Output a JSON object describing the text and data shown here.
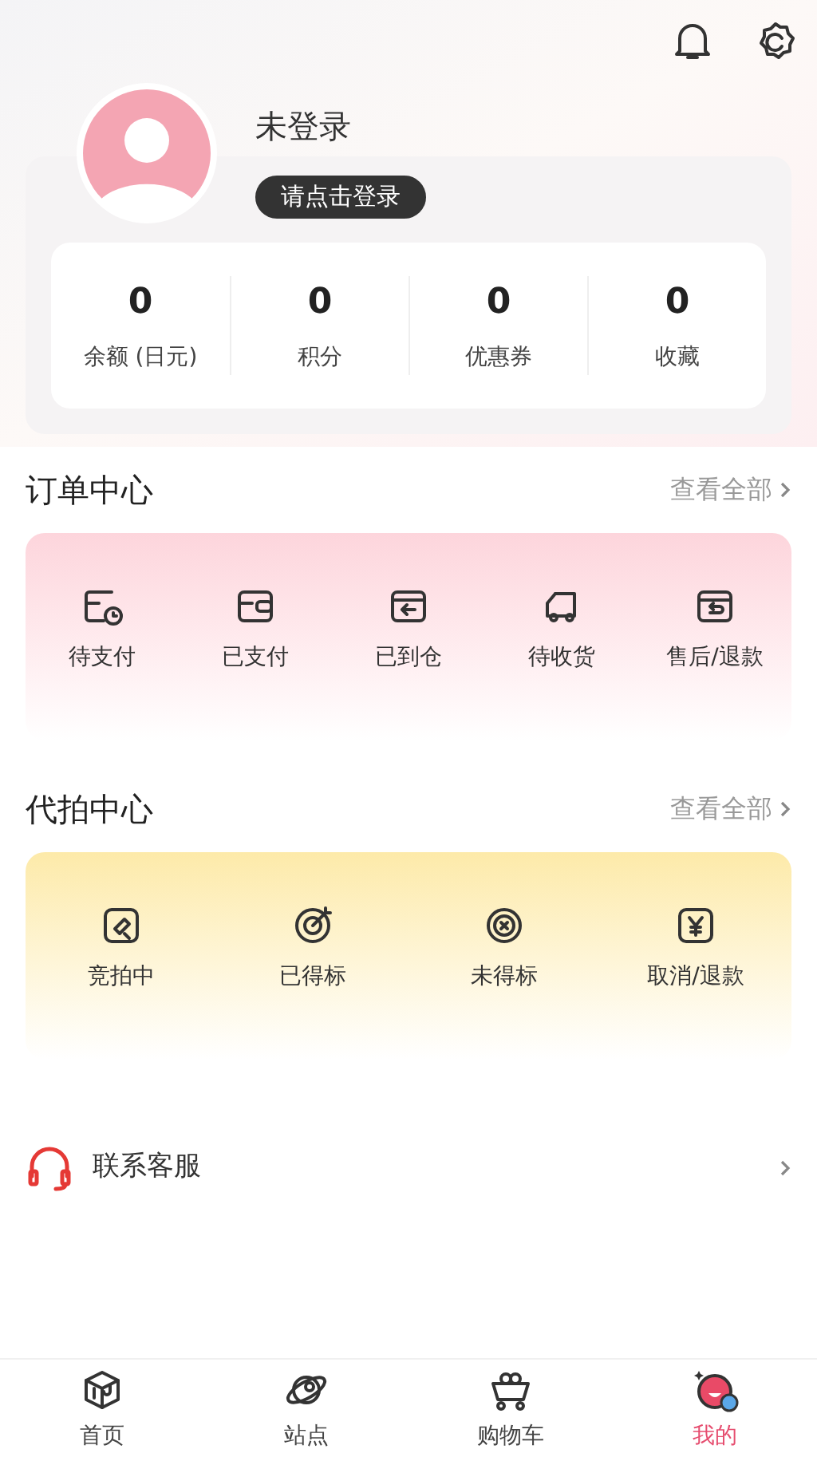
{
  "profile": {
    "name": "未登录",
    "login_button": "请点击登录"
  },
  "stats": [
    {
      "value": "0",
      "label": "余额 (日元)"
    },
    {
      "value": "0",
      "label": "积分"
    },
    {
      "value": "0",
      "label": "优惠券"
    },
    {
      "value": "0",
      "label": "收藏"
    }
  ],
  "order_center": {
    "title": "订单中心",
    "view_all": "查看全部",
    "items": [
      {
        "kind": "pending-pay",
        "label": "待支付"
      },
      {
        "kind": "paid",
        "label": "已支付"
      },
      {
        "kind": "arrived",
        "label": "已到仓"
      },
      {
        "kind": "shipping",
        "label": "待收货"
      },
      {
        "kind": "refund",
        "label": "售后/退款"
      }
    ]
  },
  "bid_center": {
    "title": "代拍中心",
    "view_all": "查看全部",
    "items": [
      {
        "kind": "bidding",
        "label": "竞拍中"
      },
      {
        "kind": "won",
        "label": "已得标"
      },
      {
        "kind": "lost",
        "label": "未得标"
      },
      {
        "kind": "cancel",
        "label": "取消/退款"
      }
    ]
  },
  "service": {
    "label": "联系客服"
  },
  "tabs": [
    {
      "kind": "home",
      "label": "首页",
      "selected": false
    },
    {
      "kind": "station",
      "label": "站点",
      "selected": false
    },
    {
      "kind": "cart",
      "label": "购物车",
      "selected": false
    },
    {
      "kind": "mine",
      "label": "我的",
      "selected": true
    }
  ]
}
